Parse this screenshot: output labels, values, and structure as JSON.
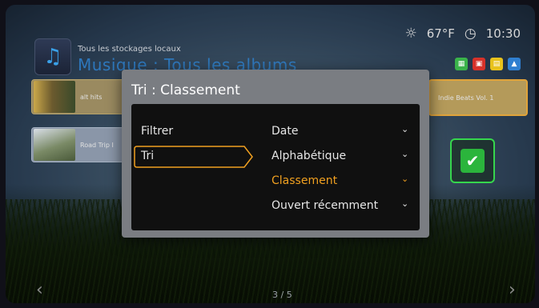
{
  "status": {
    "weather_icon": "partly-cloudy-icon",
    "temperature": "67°F",
    "clock_icon": "clock-icon",
    "time": "10:30"
  },
  "header": {
    "app_icon": "music-note-icon",
    "breadcrumb": "Tous les stockages locaux",
    "title": "Musique : Tous les albums"
  },
  "color_buttons": [
    {
      "color": "#3ab34a",
      "icon": "grid-icon"
    },
    {
      "color": "#d6322a",
      "icon": "square-icon"
    },
    {
      "color": "#e8c21c",
      "icon": "list-icon"
    },
    {
      "color": "#2f7fd0",
      "icon": "up-arrow-icon"
    }
  ],
  "albums": {
    "row1_left": "alt hits",
    "row2_left": "Road Trip I",
    "row1_right": "Indie Beats Vol. 1"
  },
  "dialog": {
    "title": "Tri : Classement",
    "left_items": [
      "Filtrer",
      "Tri"
    ],
    "options": [
      "Date",
      "Alphabétique",
      "Classement",
      "Ouvert récemment"
    ],
    "selected_index": 2,
    "chevron": "⌄"
  },
  "confirm_icon": "checkmark-icon",
  "footer": {
    "pager": "3 / 5",
    "prev_arrow": "‹",
    "next_arrow": "›"
  }
}
